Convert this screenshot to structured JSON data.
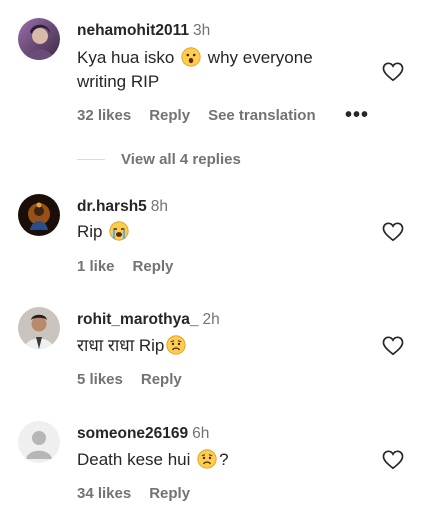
{
  "comments": [
    {
      "username": "nehamohit2011",
      "time": "3h",
      "text_before": "Kya hua isko ",
      "text_emoji": "astonished-face",
      "text_after": " why everyone writing RIP",
      "likes": "32 likes",
      "reply": "Reply",
      "translation": "See translation",
      "more": "•••"
    },
    {
      "username": "dr.harsh5",
      "time": "8h",
      "text_before": "Rip ",
      "text_emoji": "loudly-crying-face",
      "likes": "1 like",
      "reply": "Reply"
    },
    {
      "username": "rohit_marothya_",
      "time": "2h",
      "text_before": "राधा राधा Rip",
      "text_emoji": "sad-face",
      "likes": "5 likes",
      "reply": "Reply"
    },
    {
      "username": "someone26169",
      "time": "6h",
      "text_before": "Death kese hui ",
      "text_emoji": "sad-face",
      "text_after": "?",
      "likes": "34 likes",
      "reply": "Reply"
    }
  ],
  "view_replies": "View all 4 replies",
  "colors": {
    "text": "#262626",
    "muted": "#737373"
  }
}
